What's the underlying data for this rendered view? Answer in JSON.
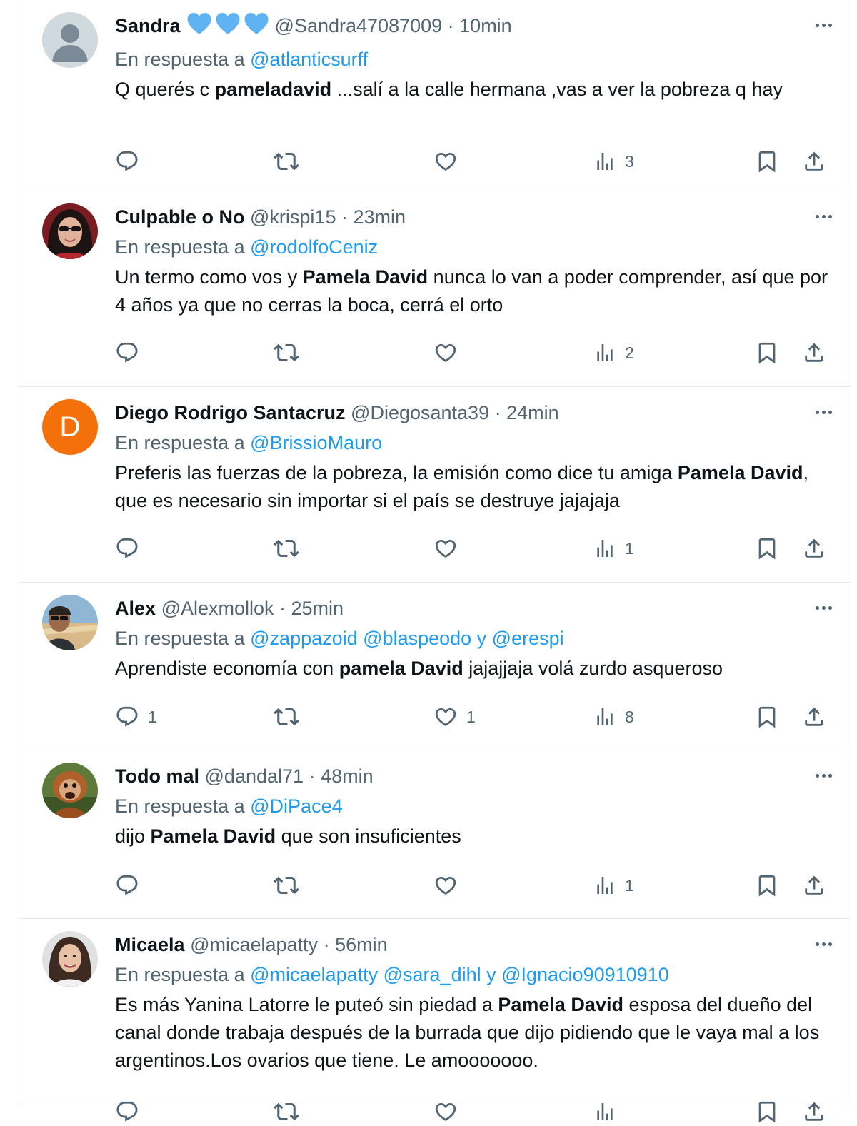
{
  "tweets": [
    {
      "name": "Sandra",
      "hearts": true,
      "handle": "@Sandra47087009",
      "time": "10min",
      "reply_prefix": "En respuesta a",
      "reply_to": "@atlanticsurff",
      "reply_extra": "",
      "text_parts": [
        {
          "t": "Q querés c ",
          "b": false
        },
        {
          "t": "pameladavid",
          "b": true
        },
        {
          "t": " ...salí a la calle hermana ,vas a ver la pobreza q hay",
          "b": false
        }
      ],
      "replies": "",
      "likes": "",
      "views": "3",
      "avatar": "default-avatar"
    },
    {
      "name": "Culpable o No",
      "hearts": false,
      "handle": "@krispi15",
      "time": "23min",
      "reply_prefix": "En respuesta a",
      "reply_to": "@rodolfoCeniz",
      "reply_extra": "",
      "text_parts": [
        {
          "t": "Un termo como vos y ",
          "b": false
        },
        {
          "t": "Pamela David",
          "b": true
        },
        {
          "t": " nunca lo van a poder comprender, así que por 4 años ya que no cerras la boca, cerrá el orto",
          "b": false
        }
      ],
      "replies": "",
      "likes": "",
      "views": "2",
      "avatar": "photo-woman-sunglasses"
    },
    {
      "name": "Diego Rodrigo Santacruz",
      "hearts": false,
      "handle": "@Diegosanta39",
      "time": "24min",
      "reply_prefix": "En respuesta a",
      "reply_to": "@BrissioMauro",
      "reply_extra": "",
      "text_parts": [
        {
          "t": "Preferis las fuerzas de la pobreza, la emisión  como dice tu amiga ",
          "b": false
        },
        {
          "t": "Pamela David",
          "b": true
        },
        {
          "t": ", que es necesario sin importar si el país se destruye jajajaja",
          "b": false
        }
      ],
      "replies": "",
      "likes": "",
      "views": "1",
      "avatar": "letter-avatar",
      "avatar_letter": "D"
    },
    {
      "name": "Alex",
      "hearts": false,
      "handle": "@Alexmollok",
      "time": "25min",
      "reply_prefix": "En respuesta a",
      "reply_to": "@zappazoid @blaspeodo y @erespi",
      "reply_extra": "",
      "text_parts": [
        {
          "t": "Aprendiste economía con ",
          "b": false
        },
        {
          "t": "pamela David",
          "b": true
        },
        {
          "t": " jajajjaja volá zurdo asqueroso",
          "b": false
        }
      ],
      "replies": "1",
      "likes": "1",
      "views": "8",
      "avatar": "photo-man-beach"
    },
    {
      "name": "Todo mal",
      "hearts": false,
      "handle": "@dandal71",
      "time": "48min",
      "reply_prefix": "En respuesta a",
      "reply_to": "@DiPace4",
      "reply_extra": "",
      "text_parts": [
        {
          "t": "dijo ",
          "b": false
        },
        {
          "t": "Pamela David",
          "b": true
        },
        {
          "t": " que son insuficientes",
          "b": false
        }
      ],
      "replies": "",
      "likes": "",
      "views": "1",
      "avatar": "photo-orangutan"
    },
    {
      "name": "Micaela",
      "hearts": false,
      "handle": "@micaelapatty",
      "time": "56min",
      "reply_prefix": "En respuesta a",
      "reply_to": "@micaelapatty @sara_dihl y @Ignacio90910910",
      "reply_extra": "",
      "text_parts": [
        {
          "t": "Es más Yanina Latorre le puteó sin piedad a ",
          "b": false
        },
        {
          "t": "Pamela David",
          "b": true
        },
        {
          "t": " esposa del dueño del canal donde trabaja después de la burrada que dijo pidiendo que le vaya mal a los argentinos.Los ovarios que tiene. Le amooooooo.",
          "b": false
        }
      ],
      "replies": "",
      "likes": "",
      "views": "",
      "avatar": "photo-woman-smiling"
    }
  ],
  "colors": {
    "text": "#0f1419",
    "secondary": "#536471",
    "mention": "#1d9bf0",
    "heart_blue": "#5fb3f3",
    "letter_avatar": "#f4700a"
  },
  "icons": [
    "more-icon",
    "reply-icon",
    "retweet-icon",
    "like-icon",
    "views-icon",
    "bookmark-icon",
    "share-icon",
    "blue-heart-icon"
  ]
}
